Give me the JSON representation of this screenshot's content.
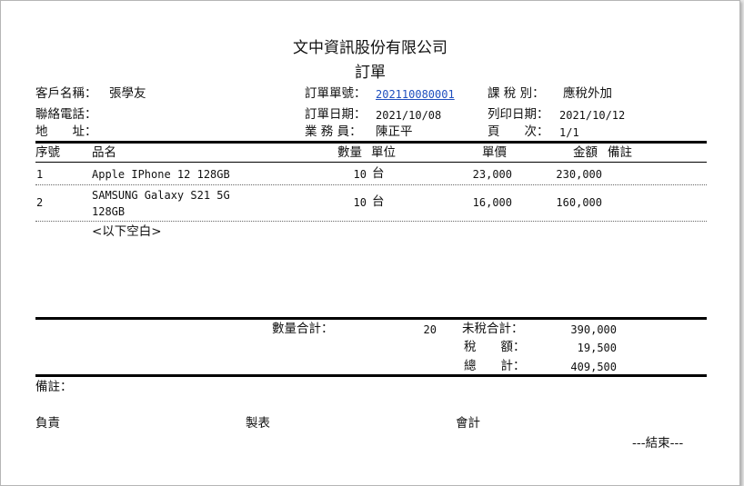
{
  "company_name": "文中資訊股份有限公司",
  "doc_title": "訂單",
  "header": {
    "customer_label": "客戶名稱：",
    "customer_value": "張學友",
    "phone_label": "聯絡電話：",
    "address_label": "地　　址：",
    "order_no_label": "訂單單號：",
    "order_no_value": "202110080001",
    "order_date_label": "訂單日期：",
    "order_date_value": "2021/10/08",
    "salesperson_label": "業 務 員：",
    "salesperson_value": "陳正平",
    "tax_type_label": "課 稅 別：",
    "tax_type_value": "應稅外加",
    "print_date_label": "列印日期：",
    "print_date_value": "2021/10/12",
    "page_label": "頁　　次：",
    "page_value": "1/1"
  },
  "table": {
    "columns": {
      "seq": "序號",
      "name": "品名",
      "qty": "數量",
      "unit": "單位",
      "price": "單價",
      "amount": "金額",
      "note": "備註"
    },
    "rows": [
      {
        "seq": "1",
        "name_line1": "Apple IPhone 12 128GB",
        "name_line2": "",
        "qty": "10",
        "unit": "台",
        "price": "23,000",
        "amount": "230,000"
      },
      {
        "seq": "2",
        "name_line1": "SAMSUNG Galaxy S21 5G",
        "name_line2": "128GB",
        "qty": "10",
        "unit": "台",
        "price": "16,000",
        "amount": "160,000"
      }
    ],
    "blank_marker": "<以下空白>"
  },
  "totals": {
    "qty_total_label": "數量合計：",
    "qty_total_value": "20",
    "pretax_label": "未稅合計：",
    "pretax_value": "390,000",
    "tax_label": "稅　　額：",
    "tax_value": "19,500",
    "grand_label": "總　　計：",
    "grand_value": "409,500"
  },
  "footer": {
    "remark_label": "備註：",
    "responsible_label": "負責",
    "preparer_label": "製表",
    "accounting_label": "會計",
    "end_marker": "---結束---"
  }
}
